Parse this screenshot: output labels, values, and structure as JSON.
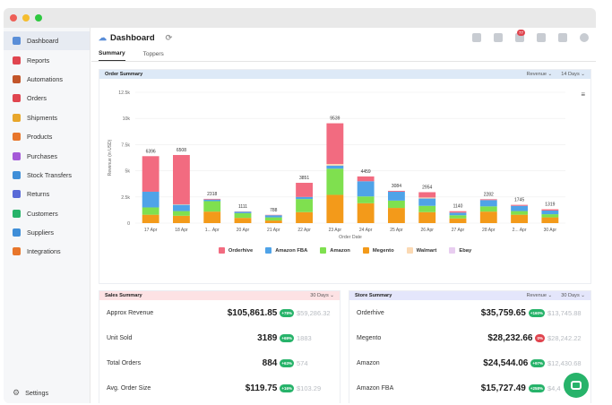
{
  "window": {
    "dots": [
      "#ee5f57",
      "#f5bd2e",
      "#2ec840"
    ]
  },
  "sidebar": {
    "items": [
      {
        "label": "Dashboard",
        "icon": "dashboard-icon",
        "color": "#5a8ed8",
        "active": true
      },
      {
        "label": "Reports",
        "icon": "reports-icon",
        "color": "#e0454f"
      },
      {
        "label": "Automations",
        "icon": "automations-icon",
        "color": "#c2552a"
      },
      {
        "label": "Orders",
        "icon": "orders-icon",
        "color": "#e0454f"
      },
      {
        "label": "Shipments",
        "icon": "shipments-icon",
        "color": "#e8a62b"
      },
      {
        "label": "Products",
        "icon": "products-icon",
        "color": "#e8762b"
      },
      {
        "label": "Purchases",
        "icon": "purchases-icon",
        "color": "#a55ad8"
      },
      {
        "label": "Stock Transfers",
        "icon": "stock-transfers-icon",
        "color": "#3f8ed8"
      },
      {
        "label": "Returns",
        "icon": "returns-icon",
        "color": "#5a6bd8"
      },
      {
        "label": "Customers",
        "icon": "customers-icon",
        "color": "#27b36a"
      },
      {
        "label": "Suppliers",
        "icon": "suppliers-icon",
        "color": "#3f8ed8"
      },
      {
        "label": "Integrations",
        "icon": "integrations-icon",
        "color": "#e8762b"
      }
    ],
    "settings_label": "Settings"
  },
  "header": {
    "title": "Dashboard",
    "notifications_count": "77"
  },
  "tabs": [
    {
      "label": "Summary",
      "active": true
    },
    {
      "label": "Toppers"
    }
  ],
  "order_summary": {
    "title": "Order Summary",
    "metric": "Revenue",
    "period": "14 Days"
  },
  "chart_data": {
    "type": "bar",
    "stacked": true,
    "categories": [
      "17 Apr",
      "18 Apr",
      "1... Apr",
      "20 Apr",
      "21 Apr",
      "22 Apr",
      "23 Apr",
      "24 Apr",
      "25 Apr",
      "26 Apr",
      "27 Apr",
      "28 Apr",
      "2... Apr",
      "30 Apr"
    ],
    "totals": [
      "6396",
      "6508",
      "2318",
      "1111",
      "788",
      "3851",
      "9539",
      "4459",
      "3084",
      "2954",
      "1140",
      "2282",
      "1745",
      "1319"
    ],
    "series": [
      {
        "name": "Megento",
        "color": "#f39a1a",
        "values": [
          800,
          700,
          1100,
          500,
          250,
          1050,
          2700,
          1900,
          1450,
          1050,
          450,
          1100,
          800,
          550
        ]
      },
      {
        "name": "Amazon",
        "color": "#7fe04f",
        "values": [
          700,
          450,
          1000,
          450,
          300,
          1250,
          2500,
          650,
          700,
          600,
          300,
          500,
          350,
          300
        ]
      },
      {
        "name": "Amazon FBA",
        "color": "#4fa3e8",
        "values": [
          1500,
          600,
          150,
          150,
          200,
          200,
          300,
          1450,
          850,
          700,
          250,
          600,
          500,
          350
        ]
      },
      {
        "name": "Ebay",
        "color": "#e8cdf0",
        "values": [
          0,
          0,
          0,
          0,
          0,
          0,
          0,
          0,
          0,
          0,
          0,
          0,
          0,
          0
        ]
      },
      {
        "name": "Walmart",
        "color": "#fbd9b3",
        "values": [
          0,
          50,
          0,
          0,
          0,
          0,
          150,
          0,
          0,
          100,
          0,
          0,
          0,
          0
        ]
      },
      {
        "name": "Orderhive",
        "color": "#f26b80",
        "values": [
          3396,
          4708,
          68,
          11,
          38,
          1351,
          3889,
          459,
          84,
          504,
          140,
          82,
          95,
          119
        ]
      }
    ],
    "legend": [
      "Orderhive",
      "Amazon FBA",
      "Amazon",
      "Megento",
      "Walmart",
      "Ebay"
    ],
    "legend_colors": [
      "#f26b80",
      "#4fa3e8",
      "#7fe04f",
      "#f39a1a",
      "#fbd9b3",
      "#e8cdf0"
    ],
    "yticks": [
      "0",
      "2.5k",
      "5k",
      "7.5k",
      "10k",
      "12.5k"
    ],
    "ylim": [
      0,
      12500
    ],
    "ylabel": "Revenue (in USD)",
    "xlabel": "Order Date",
    "grid": true,
    "legend_position": "bottom"
  },
  "sales_summary": {
    "title": "Sales Summary",
    "period": "30 Days",
    "rows": [
      {
        "label": "Approx Revenue",
        "value": "$105,861.85",
        "change": "+78%",
        "change_color": "#27b36a",
        "previous": "$59,286.32"
      },
      {
        "label": "Unit Sold",
        "value": "3189",
        "change": "+69%",
        "change_color": "#27b36a",
        "previous": "1883"
      },
      {
        "label": "Total Orders",
        "value": "884",
        "change": "+63%",
        "change_color": "#27b36a",
        "previous": "574"
      },
      {
        "label": "Avg. Order Size",
        "value": "$119.75",
        "change": "+16%",
        "change_color": "#27b36a",
        "previous": "$103.29"
      }
    ]
  },
  "store_summary": {
    "title": "Store Summary",
    "metric": "Revenue",
    "period": "30 Days",
    "rows": [
      {
        "label": "Orderhive",
        "value": "$35,759.65",
        "change": "+160%",
        "change_color": "#27b36a",
        "previous": "$13,745.88"
      },
      {
        "label": "Megento",
        "value": "$28,232.66",
        "change": "0%",
        "change_color": "#e0454f",
        "previous": "$28,242.22"
      },
      {
        "label": "Amazon",
        "value": "$24,544.06",
        "change": "+97%",
        "change_color": "#27b36a",
        "previous": "$12,430.68"
      },
      {
        "label": "Amazon FBA",
        "value": "$15,727.49",
        "change": "+258%",
        "change_color": "#27b36a",
        "previous": "$4,4"
      }
    ]
  }
}
